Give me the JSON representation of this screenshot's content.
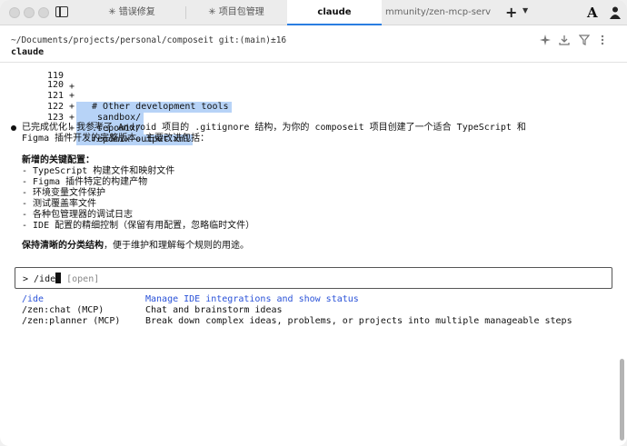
{
  "tabs": [
    {
      "label": "✳ 错误修复"
    },
    {
      "label": "✳ 项目包管理"
    },
    {
      "label": "claude"
    },
    {
      "label": "mmunity/zen-mcp-serv"
    }
  ],
  "header": {
    "path": "~/Documents/projects/personal/composeit git:(main)±16",
    "session": "claude"
  },
  "diff": [
    {
      "num": "119",
      "mark": "+",
      "code": ""
    },
    {
      "num": "120",
      "mark": "+",
      "code": " # Other development tools"
    },
    {
      "num": "121",
      "mark": "+",
      "code": " _sandbox/"
    },
    {
      "num": "122",
      "mark": "+",
      "code": " .repomix/"
    },
    {
      "num": "123",
      "mark": "+",
      "code": " repomix-output.xml"
    }
  ],
  "message": {
    "line1": "已完成优化！我参考了 Android 项目的 .gitignore 结构，为你的 composeit 项目创建了一个适合 TypeScript 和",
    "line2": "Figma 插件开发的完整版本。主要改进包括：",
    "section1_title": "新增的关键配置：",
    "items": [
      "- TypeScript 构建文件和映射文件",
      "- Figma 插件特定的构建产物",
      "- 环境变量文件保护",
      "- 测试覆盖率文件",
      "- 各种包管理器的调试日志",
      "- IDE 配置的精细控制（保留有用配置，忽略临时文件）"
    ],
    "section2_title": "保持清晰的分类结构",
    "section2_rest": "，便于维护和理解每个规则的用途。"
  },
  "input": {
    "prompt": "> /ide",
    "hint": "[open]"
  },
  "suggestions": [
    {
      "cmd": "/ide",
      "desc": "Manage IDE integrations and show status"
    },
    {
      "cmd": "/zen:chat (MCP)",
      "desc": "Chat and brainstorm ideas"
    },
    {
      "cmd": "/zen:planner (MCP)",
      "desc": "Break down complex ideas, problems, or projects into multiple manageable steps"
    }
  ],
  "icons": {
    "header": [
      "sparkle-icon",
      "download-icon",
      "filter-icon",
      "more-icon"
    ]
  },
  "colors": {
    "accent": "#2a7de1",
    "highlight": "#b7d3f7",
    "selected_command": "#2a52d8"
  }
}
